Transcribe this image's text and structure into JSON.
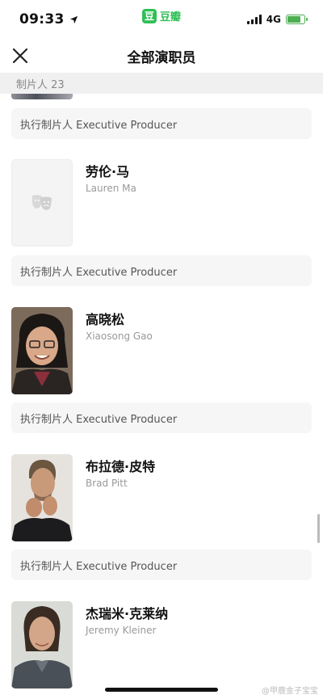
{
  "status_bar": {
    "time": "09:33",
    "network": "4G",
    "app_name": "豆瓣",
    "app_logo_char": "豆",
    "accent": "#2fbf55",
    "battery_color": "#4caf50",
    "battery_level": 0.8
  },
  "nav": {
    "title": "全部演职员",
    "close_icon": "close-icon"
  },
  "section": {
    "label": "制片人 23"
  },
  "people": [
    {
      "role": "执行制片人 Executive Producer"
    },
    {
      "name": "劳伦·马",
      "en_name": "Lauren Ma",
      "role": "执行制片人 Executive Producer",
      "photo": "placeholder-mask-icon"
    },
    {
      "name": "高晓松",
      "en_name": "Xiaosong Gao",
      "role": "执行制片人 Executive Producer",
      "photo": "portrait"
    },
    {
      "name": "布拉德·皮特",
      "en_name": "Brad Pitt",
      "role": "执行制片人 Executive Producer",
      "photo": "portrait"
    },
    {
      "name": "杰瑞米·克莱纳",
      "en_name": "Jeremy Kleiner",
      "photo": "portrait"
    }
  ],
  "watermark": "@甲鹿金子宝宝"
}
